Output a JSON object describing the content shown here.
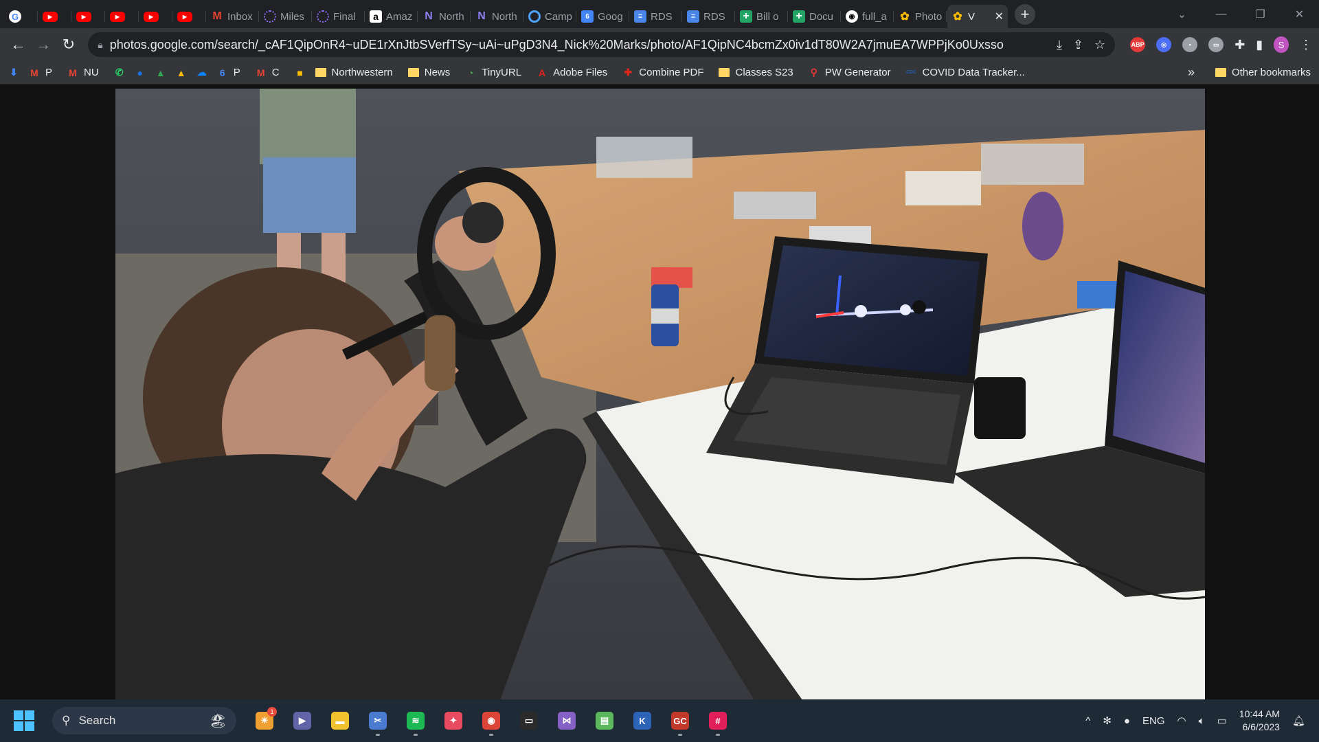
{
  "tabs": [
    {
      "icon": "google-icon",
      "label": "",
      "glyph": "G"
    },
    {
      "icon": "youtube-icon",
      "label": "",
      "glyph": "▶"
    },
    {
      "icon": "youtube-icon",
      "label": "",
      "glyph": "▶"
    },
    {
      "icon": "youtube-icon",
      "label": "",
      "glyph": "▶"
    },
    {
      "icon": "youtube-icon",
      "label": "",
      "glyph": "▶"
    },
    {
      "icon": "youtube-icon",
      "label": "",
      "glyph": "▶"
    },
    {
      "icon": "gmail-icon",
      "label": "Inbox",
      "glyph": "M"
    },
    {
      "icon": "milestone-icon",
      "label": "Miles",
      "glyph": ""
    },
    {
      "icon": "ring-icon",
      "label": "Final",
      "glyph": ""
    },
    {
      "icon": "amazon-icon",
      "label": "Amaz",
      "glyph": "a"
    },
    {
      "icon": "northwestern-icon",
      "label": "North",
      "glyph": "N"
    },
    {
      "icon": "northwestern-icon",
      "label": "North",
      "glyph": "N"
    },
    {
      "icon": "canvas-icon",
      "label": "Camp",
      "glyph": ""
    },
    {
      "icon": "google-calendar-icon",
      "label": "Goog",
      "glyph": "6"
    },
    {
      "icon": "google-docs-icon",
      "label": "RDS",
      "glyph": "≡"
    },
    {
      "icon": "google-docs-icon",
      "label": "RDS",
      "glyph": "≡"
    },
    {
      "icon": "google-sheets-icon",
      "label": "Bill o",
      "glyph": "+"
    },
    {
      "icon": "google-sheets-icon",
      "label": "Docu",
      "glyph": "+"
    },
    {
      "icon": "github-icon",
      "label": "full_a",
      "glyph": "◉"
    },
    {
      "icon": "google-photos-icon",
      "label": "Photo",
      "glyph": "✿"
    },
    {
      "icon": "google-photos-icon",
      "label": "V",
      "glyph": "✿",
      "active": true
    }
  ],
  "toolbar": {
    "url": "photos.google.com/search/_cAF1QipOnR4~uDE1rXnJtbSVerfTSy~uAi~uPgD3N4_Nick%20Marks/photo/AF1QipNC4bcmZx0iv1dT80W2A7jmuEA7WPPjKo0Uxsso",
    "extensions": [
      {
        "name": "adblock-plus-icon",
        "label": "ABP",
        "color": "#e33a3a"
      },
      {
        "name": "extension-blue-icon",
        "label": "◎",
        "color": "#4c6ef5"
      },
      {
        "name": "extension-square-icon",
        "label": "▪",
        "color": "#9aa0a6"
      },
      {
        "name": "extension-keyboard-icon",
        "label": "▭",
        "color": "#9aa0a6"
      }
    ],
    "avatar": "S"
  },
  "bookmarks": [
    {
      "icon": "bookmark-app-icon",
      "label": "",
      "glyph": "⬇",
      "color": "#4285f4"
    },
    {
      "icon": "gmail-icon",
      "label": "P",
      "glyph": "M",
      "color": "#ea4335"
    },
    {
      "icon": "gmail-icon",
      "label": "NU",
      "glyph": "M",
      "color": "#ea4335"
    },
    {
      "icon": "whatsapp-icon",
      "label": "",
      "glyph": "✆",
      "color": "#25d366"
    },
    {
      "icon": "messages-icon",
      "label": "",
      "glyph": "●",
      "color": "#1a73e8"
    },
    {
      "icon": "google-drive-icon",
      "label": "",
      "glyph": "▲",
      "color": "#34a853"
    },
    {
      "icon": "google-drive-icon",
      "label": "",
      "glyph": "▲",
      "color": "#fbbc04"
    },
    {
      "icon": "onedrive-icon",
      "label": "",
      "glyph": "☁",
      "color": "#0a84ff"
    },
    {
      "icon": "google-calendar-icon",
      "label": "P",
      "glyph": "6",
      "color": "#4285f4"
    },
    {
      "icon": "gmail-icon",
      "label": "C",
      "glyph": "M",
      "color": "#ea4335"
    },
    {
      "icon": "google-keep-icon",
      "label": "",
      "glyph": "■",
      "color": "#fbbc04"
    },
    {
      "icon": "folder-icon",
      "label": "Northwestern",
      "folder": true
    },
    {
      "icon": "folder-icon",
      "label": "News",
      "folder": true
    },
    {
      "icon": "tinyurl-icon",
      "label": "TinyURL",
      "glyph": "◔",
      "color": "#4caf50"
    },
    {
      "icon": "adobe-icon",
      "label": "Adobe Files",
      "glyph": "A",
      "color": "#e1251b"
    },
    {
      "icon": "combine-pdf-icon",
      "label": "Combine PDF",
      "glyph": "✚",
      "color": "#e1251b"
    },
    {
      "icon": "folder-icon",
      "label": "Classes S23",
      "folder": true
    },
    {
      "icon": "key-icon",
      "label": "PW Generator",
      "glyph": "⚲",
      "color": "#e53935"
    },
    {
      "icon": "cdc-icon",
      "label": "COVID Data Tracker...",
      "glyph": "CDC",
      "color": "#1c5fae"
    }
  ],
  "bookmarks_more": "»",
  "other_bookmarks": "Other bookmarks",
  "taskbar": {
    "search_label": "Search",
    "apps": [
      {
        "name": "weather-app-icon",
        "glyph": "☀",
        "color": "#f0a030",
        "badge": "1"
      },
      {
        "name": "teams-chat-icon",
        "glyph": "▶",
        "color": "#6264a7"
      },
      {
        "name": "file-explorer-icon",
        "glyph": "▬",
        "color": "#f2c12e"
      },
      {
        "name": "snipping-tool-icon",
        "glyph": "✂",
        "color": "#4a7bd0",
        "running": true
      },
      {
        "name": "spotify-icon",
        "glyph": "≋",
        "color": "#1db954",
        "running": true
      },
      {
        "name": "photo-app-icon",
        "glyph": "✦",
        "color": "#e84a5f"
      },
      {
        "name": "chrome-icon",
        "glyph": "◉",
        "color": "#db4437",
        "running": true
      },
      {
        "name": "terminal-icon",
        "glyph": "▭",
        "color": "#2b2b2b"
      },
      {
        "name": "visual-studio-icon",
        "glyph": "⋈",
        "color": "#8661c5"
      },
      {
        "name": "image-editor-icon",
        "glyph": "▤",
        "color": "#5cb85c"
      },
      {
        "name": "kicad-icon",
        "glyph": "K",
        "color": "#2e64b8"
      },
      {
        "name": "gc-app-icon",
        "glyph": "GC",
        "color": "#c0392b",
        "running": true
      },
      {
        "name": "slack-icon",
        "glyph": "#",
        "color": "#e01e5a",
        "running": true
      }
    ],
    "tray": {
      "language": "ENG",
      "time": "10:44 AM",
      "date": "6/6/2023"
    }
  },
  "colors": {
    "accent": "#8ab4f8",
    "taskbar": "#1f2a37",
    "chrome_dark": "#202124"
  }
}
